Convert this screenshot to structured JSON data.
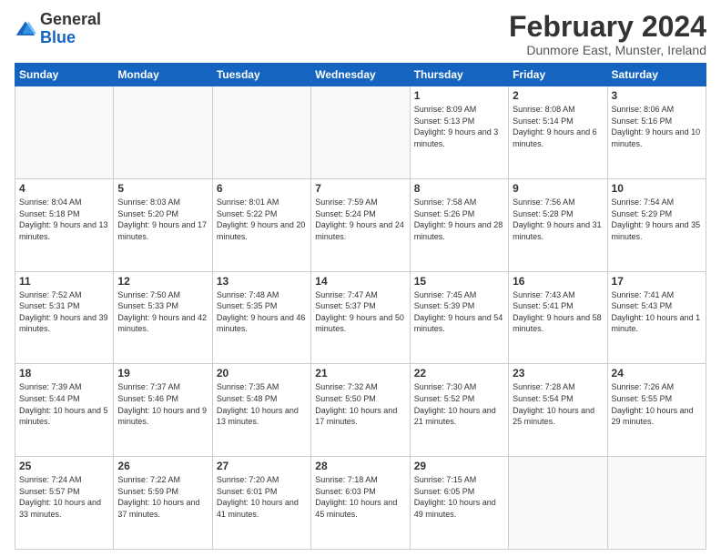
{
  "header": {
    "logo": {
      "line1": "General",
      "line2": "Blue"
    },
    "title": "February 2024",
    "location": "Dunmore East, Munster, Ireland"
  },
  "calendar": {
    "days_of_week": [
      "Sunday",
      "Monday",
      "Tuesday",
      "Wednesday",
      "Thursday",
      "Friday",
      "Saturday"
    ],
    "weeks": [
      [
        {
          "day": "",
          "info": ""
        },
        {
          "day": "",
          "info": ""
        },
        {
          "day": "",
          "info": ""
        },
        {
          "day": "",
          "info": ""
        },
        {
          "day": "1",
          "info": "Sunrise: 8:09 AM\nSunset: 5:13 PM\nDaylight: 9 hours\nand 3 minutes."
        },
        {
          "day": "2",
          "info": "Sunrise: 8:08 AM\nSunset: 5:14 PM\nDaylight: 9 hours\nand 6 minutes."
        },
        {
          "day": "3",
          "info": "Sunrise: 8:06 AM\nSunset: 5:16 PM\nDaylight: 9 hours\nand 10 minutes."
        }
      ],
      [
        {
          "day": "4",
          "info": "Sunrise: 8:04 AM\nSunset: 5:18 PM\nDaylight: 9 hours\nand 13 minutes."
        },
        {
          "day": "5",
          "info": "Sunrise: 8:03 AM\nSunset: 5:20 PM\nDaylight: 9 hours\nand 17 minutes."
        },
        {
          "day": "6",
          "info": "Sunrise: 8:01 AM\nSunset: 5:22 PM\nDaylight: 9 hours\nand 20 minutes."
        },
        {
          "day": "7",
          "info": "Sunrise: 7:59 AM\nSunset: 5:24 PM\nDaylight: 9 hours\nand 24 minutes."
        },
        {
          "day": "8",
          "info": "Sunrise: 7:58 AM\nSunset: 5:26 PM\nDaylight: 9 hours\nand 28 minutes."
        },
        {
          "day": "9",
          "info": "Sunrise: 7:56 AM\nSunset: 5:28 PM\nDaylight: 9 hours\nand 31 minutes."
        },
        {
          "day": "10",
          "info": "Sunrise: 7:54 AM\nSunset: 5:29 PM\nDaylight: 9 hours\nand 35 minutes."
        }
      ],
      [
        {
          "day": "11",
          "info": "Sunrise: 7:52 AM\nSunset: 5:31 PM\nDaylight: 9 hours\nand 39 minutes."
        },
        {
          "day": "12",
          "info": "Sunrise: 7:50 AM\nSunset: 5:33 PM\nDaylight: 9 hours\nand 42 minutes."
        },
        {
          "day": "13",
          "info": "Sunrise: 7:48 AM\nSunset: 5:35 PM\nDaylight: 9 hours\nand 46 minutes."
        },
        {
          "day": "14",
          "info": "Sunrise: 7:47 AM\nSunset: 5:37 PM\nDaylight: 9 hours\nand 50 minutes."
        },
        {
          "day": "15",
          "info": "Sunrise: 7:45 AM\nSunset: 5:39 PM\nDaylight: 9 hours\nand 54 minutes."
        },
        {
          "day": "16",
          "info": "Sunrise: 7:43 AM\nSunset: 5:41 PM\nDaylight: 9 hours\nand 58 minutes."
        },
        {
          "day": "17",
          "info": "Sunrise: 7:41 AM\nSunset: 5:43 PM\nDaylight: 10 hours\nand 1 minute."
        }
      ],
      [
        {
          "day": "18",
          "info": "Sunrise: 7:39 AM\nSunset: 5:44 PM\nDaylight: 10 hours\nand 5 minutes."
        },
        {
          "day": "19",
          "info": "Sunrise: 7:37 AM\nSunset: 5:46 PM\nDaylight: 10 hours\nand 9 minutes."
        },
        {
          "day": "20",
          "info": "Sunrise: 7:35 AM\nSunset: 5:48 PM\nDaylight: 10 hours\nand 13 minutes."
        },
        {
          "day": "21",
          "info": "Sunrise: 7:32 AM\nSunset: 5:50 PM\nDaylight: 10 hours\nand 17 minutes."
        },
        {
          "day": "22",
          "info": "Sunrise: 7:30 AM\nSunset: 5:52 PM\nDaylight: 10 hours\nand 21 minutes."
        },
        {
          "day": "23",
          "info": "Sunrise: 7:28 AM\nSunset: 5:54 PM\nDaylight: 10 hours\nand 25 minutes."
        },
        {
          "day": "24",
          "info": "Sunrise: 7:26 AM\nSunset: 5:55 PM\nDaylight: 10 hours\nand 29 minutes."
        }
      ],
      [
        {
          "day": "25",
          "info": "Sunrise: 7:24 AM\nSunset: 5:57 PM\nDaylight: 10 hours\nand 33 minutes."
        },
        {
          "day": "26",
          "info": "Sunrise: 7:22 AM\nSunset: 5:59 PM\nDaylight: 10 hours\nand 37 minutes."
        },
        {
          "day": "27",
          "info": "Sunrise: 7:20 AM\nSunset: 6:01 PM\nDaylight: 10 hours\nand 41 minutes."
        },
        {
          "day": "28",
          "info": "Sunrise: 7:18 AM\nSunset: 6:03 PM\nDaylight: 10 hours\nand 45 minutes."
        },
        {
          "day": "29",
          "info": "Sunrise: 7:15 AM\nSunset: 6:05 PM\nDaylight: 10 hours\nand 49 minutes."
        },
        {
          "day": "",
          "info": ""
        },
        {
          "day": "",
          "info": ""
        }
      ]
    ]
  }
}
